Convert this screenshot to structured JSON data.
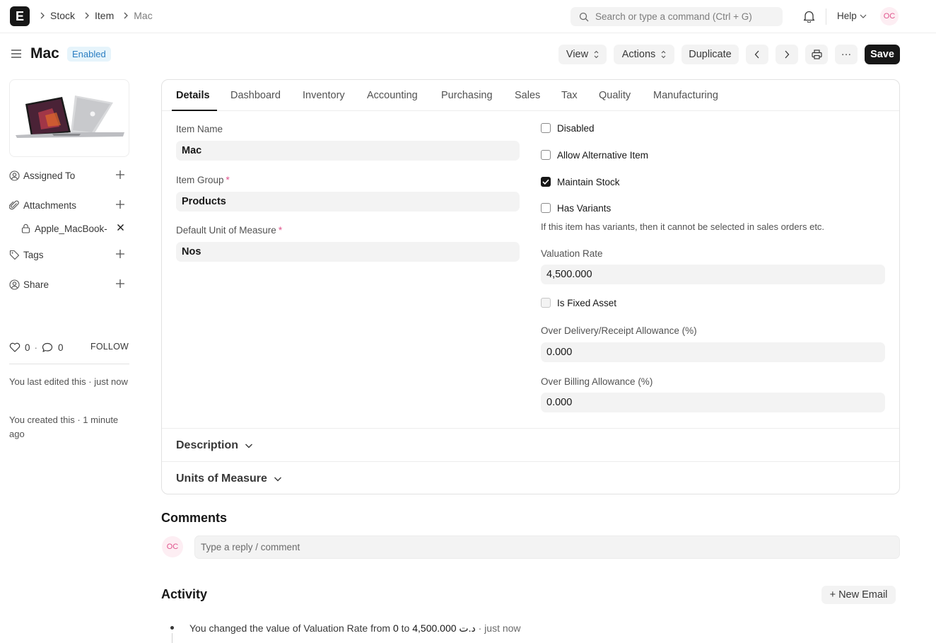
{
  "navbar": {
    "logo_letter": "E",
    "breadcrumbs": [
      "Stock",
      "Item",
      "Mac"
    ],
    "search_placeholder": "Search or type a command (Ctrl + G)",
    "help_label": "Help",
    "avatar_initials": "OC"
  },
  "header": {
    "title": "Mac",
    "status": "Enabled",
    "view_label": "View",
    "actions_label": "Actions",
    "duplicate_label": "Duplicate",
    "save_label": "Save",
    "more_label": "···"
  },
  "sidebar": {
    "assigned_to": "Assigned To",
    "attachments": "Attachments",
    "attachment_file": "Apple_MacBook-",
    "tags": "Tags",
    "share": "Share",
    "likes": "0",
    "comments_count": "0",
    "follow": "FOLLOW",
    "last_edited": "You last edited this · just now",
    "created": "You created this · 1 minute ago"
  },
  "tabs": [
    "Details",
    "Dashboard",
    "Inventory",
    "Accounting",
    "Purchasing",
    "Sales",
    "Tax",
    "Quality",
    "Manufacturing"
  ],
  "form": {
    "item_name_label": "Item Name",
    "item_name": "Mac",
    "item_group_label": "Item Group",
    "item_group": "Products",
    "uom_label": "Default Unit of Measure",
    "uom": "Nos",
    "disabled_label": "Disabled",
    "allow_alt_label": "Allow Alternative Item",
    "maintain_stock_label": "Maintain Stock",
    "has_variants_label": "Has Variants",
    "variants_help": "If this item has variants, then it cannot be selected in sales orders etc.",
    "valuation_rate_label": "Valuation Rate",
    "valuation_rate": "4,500.000",
    "fixed_asset_label": "Is Fixed Asset",
    "over_delivery_label": "Over Delivery/Receipt Allowance (%)",
    "over_delivery": "0.000",
    "over_billing_label": "Over Billing Allowance (%)",
    "over_billing": "0.000"
  },
  "sections": {
    "description": "Description",
    "units": "Units of Measure"
  },
  "comments": {
    "heading": "Comments",
    "avatar_initials": "OC",
    "placeholder": "Type a reply / comment"
  },
  "activity": {
    "heading": "Activity",
    "new_email": "+ New Email",
    "entry_prefix": "You changed the value of Valuation Rate from",
    "from_value": "0",
    "to_word": "to",
    "to_value": "4,500.000 د.ت",
    "time": "· just now"
  }
}
